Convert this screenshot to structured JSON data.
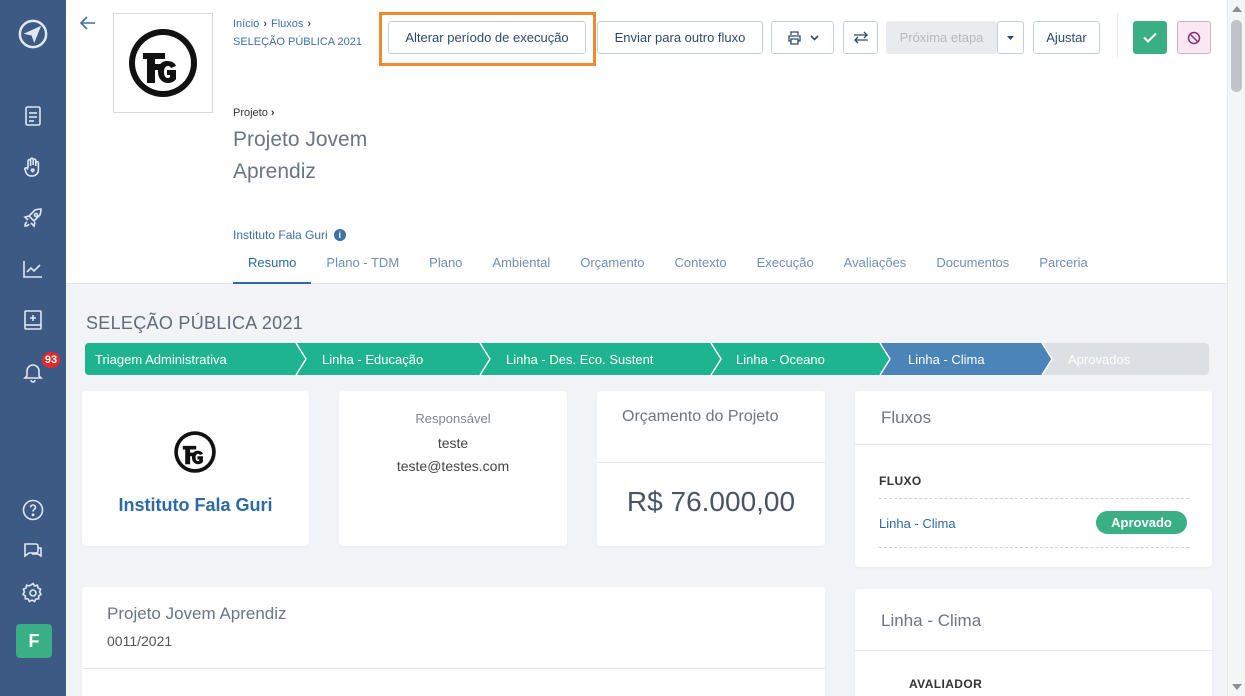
{
  "sidebar": {
    "notifications_count": "93",
    "avatar_letter": "F"
  },
  "header": {
    "breadcrumb": [
      "Início",
      "Fluxos"
    ],
    "breadcrumb_sub": "SELEÇÃO PÚBLICA 2021",
    "project_crumb": "Projeto",
    "project_title": "Projeto Jovem Aprendiz",
    "organization": "Instituto Fala Guri",
    "info_icon": "i"
  },
  "toolbar": {
    "alter_period": "Alterar período de execução",
    "send_other_flow": "Enviar para outro fluxo",
    "next_step": "Próxima etapa",
    "adjust": "Ajustar"
  },
  "tabs": [
    "Resumo",
    "Plano - TDM",
    "Plano",
    "Ambiental",
    "Orçamento",
    "Contexto",
    "Execução",
    "Avaliações",
    "Documentos",
    "Parceria"
  ],
  "section_title": "SELEÇÃO PÚBLICA 2021",
  "steps": [
    {
      "label": "Triagem Administrativa",
      "state": "done"
    },
    {
      "label": "Linha - Educação",
      "state": "done"
    },
    {
      "label": "Linha - Des. Eco. Sustent",
      "state": "done"
    },
    {
      "label": "Linha - Oceano",
      "state": "done"
    },
    {
      "label": "Linha - Clima",
      "state": "current"
    },
    {
      "label": "Aprovados",
      "state": "pending"
    }
  ],
  "org_card": {
    "name": "Instituto Fala Guri"
  },
  "responsible_card": {
    "label": "Responsável",
    "name": "teste",
    "email": "teste@testes.com"
  },
  "budget_card": {
    "title": "Orçamento do Projeto",
    "value": "R$ 76.000,00"
  },
  "flows_card": {
    "title": "Fluxos",
    "column_header": "FLUXO",
    "rows": [
      {
        "name": "Linha - Clima",
        "status": "Aprovado"
      }
    ]
  },
  "project_card": {
    "title": "Projeto Jovem Aprendiz",
    "code": "0011/2021"
  },
  "line_card": {
    "title": "Linha - Clima",
    "column_header": "AVALIADOR"
  },
  "colors": {
    "sidebar": "#3d5a85",
    "step_done": "#1fb490",
    "step_current": "#4a84b8",
    "step_pending": "#dcdfe3",
    "accent": "#2d6aa5",
    "highlight": "#f08a2c",
    "success": "#3aaf84"
  },
  "icons": {
    "sidebar": [
      "compass-logo-icon",
      "document-icon",
      "hand-heart-icon",
      "rocket-icon",
      "chart-line-icon",
      "ledger-icon",
      "bell-icon",
      "help-icon",
      "chat-icon",
      "gear-icon"
    ],
    "toolbar": [
      "printer-icon",
      "chevron-down-icon",
      "swap-arrows-icon",
      "check-icon",
      "block-icon"
    ]
  }
}
